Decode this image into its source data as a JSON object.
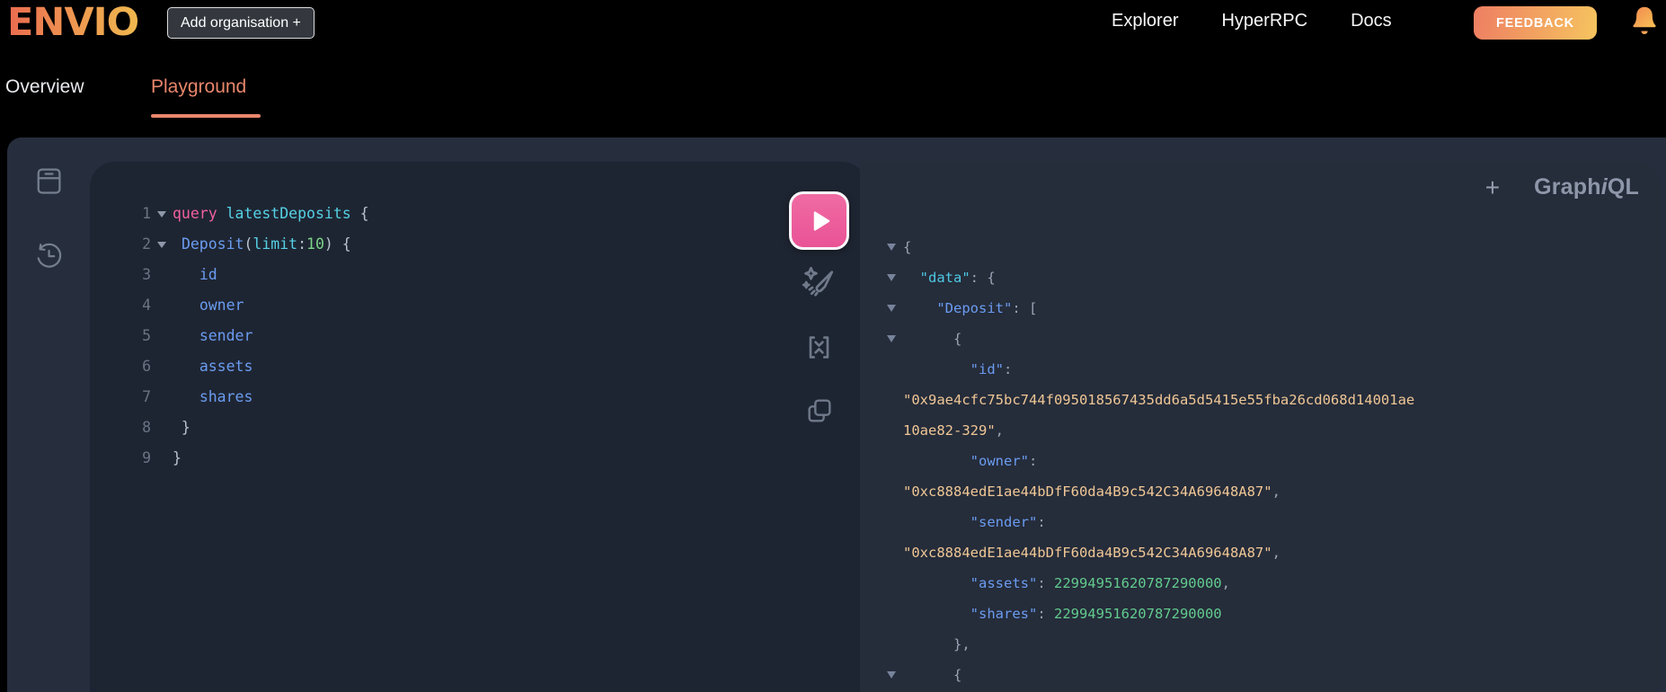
{
  "header": {
    "logo": "ENVIO",
    "add_org_label": "Add organisation +",
    "nav": [
      {
        "label": "Explorer"
      },
      {
        "label": "HyperRPC"
      },
      {
        "label": "Docs"
      }
    ],
    "feedback_label": "FEEDBACK",
    "icons": [
      "bell-icon"
    ]
  },
  "tabs": [
    {
      "label": "Overview",
      "active": false
    },
    {
      "label": "Playground",
      "active": true
    }
  ],
  "sidebar": {
    "icons": [
      "docs-icon",
      "history-icon"
    ]
  },
  "toolbar": {
    "icons": [
      "execute-icon",
      "prettify-icon",
      "merge-icon",
      "copy-icon"
    ]
  },
  "colors": {
    "brand_gradient": [
      "#ea6b50",
      "#eeb84e"
    ],
    "active_tab_accent": "#e8866b",
    "execute_button": "#ee5f9b",
    "keyword_pink": "#f2609e",
    "name_cyan": "#55d1e6",
    "field_blue": "#6b9cf1",
    "number_green": "#62cc8e",
    "string_peach": "#f0c795",
    "container_bg": "#262e3d",
    "editor_bg": "#1e2532",
    "response_bg": "#252c3a"
  },
  "editor": {
    "lines": [
      {
        "n": "1",
        "fold": true,
        "segs": [
          [
            "kw",
            "query"
          ],
          [
            "pl",
            " "
          ],
          [
            "def",
            "latestDeposits"
          ],
          [
            "pl",
            " {"
          ]
        ]
      },
      {
        "n": "2",
        "fold": true,
        "segs": [
          [
            "pl",
            " "
          ],
          [
            "prop",
            "Deposit"
          ],
          [
            "pl",
            "("
          ],
          [
            "attr",
            "limit"
          ],
          [
            "pl",
            ":"
          ],
          [
            "num",
            "10"
          ],
          [
            "pl",
            ") {"
          ]
        ]
      },
      {
        "n": "3",
        "fold": false,
        "segs": [
          [
            "pl",
            "   "
          ],
          [
            "prop",
            "id"
          ]
        ]
      },
      {
        "n": "4",
        "fold": false,
        "segs": [
          [
            "pl",
            "   "
          ],
          [
            "prop",
            "owner"
          ]
        ]
      },
      {
        "n": "5",
        "fold": false,
        "segs": [
          [
            "pl",
            "   "
          ],
          [
            "prop",
            "sender"
          ]
        ]
      },
      {
        "n": "6",
        "fold": false,
        "segs": [
          [
            "pl",
            "   "
          ],
          [
            "prop",
            "assets"
          ]
        ]
      },
      {
        "n": "7",
        "fold": false,
        "segs": [
          [
            "pl",
            "   "
          ],
          [
            "prop",
            "shares"
          ]
        ]
      },
      {
        "n": "8",
        "fold": false,
        "segs": [
          [
            "pl",
            " }"
          ]
        ]
      },
      {
        "n": "9",
        "fold": false,
        "segs": [
          [
            "pl",
            "}"
          ]
        ]
      }
    ]
  },
  "response": {
    "plus_label": "+",
    "logo": {
      "graph": "Graph",
      "i": "i",
      "ql": "QL"
    },
    "lines": [
      {
        "fold": true,
        "segs": [
          [
            "rpl",
            "{"
          ]
        ]
      },
      {
        "fold": true,
        "segs": [
          [
            "rpl",
            "  "
          ],
          [
            "cyan",
            "\"data\""
          ],
          [
            "rpl",
            ": {"
          ]
        ]
      },
      {
        "fold": true,
        "segs": [
          [
            "rpl",
            "    "
          ],
          [
            "key",
            "\"Deposit\""
          ],
          [
            "rpl",
            ": ["
          ]
        ]
      },
      {
        "fold": true,
        "segs": [
          [
            "rpl",
            "      {"
          ]
        ]
      },
      {
        "fold": false,
        "segs": [
          [
            "rpl",
            "        "
          ],
          [
            "key",
            "\"id\""
          ],
          [
            "rpl",
            ":"
          ]
        ]
      },
      {
        "fold": false,
        "segs": [
          [
            "str",
            "\"0x9ae4cfc75bc744f095018567435dd6a5d5415e55fba26cd068d14001ae"
          ]
        ]
      },
      {
        "fold": false,
        "segs": [
          [
            "str",
            "10ae82-329\""
          ],
          [
            "rpl",
            ","
          ]
        ]
      },
      {
        "fold": false,
        "segs": [
          [
            "rpl",
            "        "
          ],
          [
            "key",
            "\"owner\""
          ],
          [
            "rpl",
            ":"
          ]
        ]
      },
      {
        "fold": false,
        "segs": [
          [
            "str",
            "\"0xc8884edE1ae44bDfF60da4B9c542C34A69648A87\""
          ],
          [
            "rpl",
            ","
          ]
        ]
      },
      {
        "fold": false,
        "segs": [
          [
            "rpl",
            "        "
          ],
          [
            "key",
            "\"sender\""
          ],
          [
            "rpl",
            ":"
          ]
        ]
      },
      {
        "fold": false,
        "segs": [
          [
            "str",
            "\"0xc8884edE1ae44bDfF60da4B9c542C34A69648A87\""
          ],
          [
            "rpl",
            ","
          ]
        ]
      },
      {
        "fold": false,
        "segs": [
          [
            "rpl",
            "        "
          ],
          [
            "key",
            "\"assets\""
          ],
          [
            "rpl",
            ": "
          ],
          [
            "rnum",
            "22994951620787290000"
          ],
          [
            "rpl",
            ","
          ]
        ]
      },
      {
        "fold": false,
        "segs": [
          [
            "rpl",
            "        "
          ],
          [
            "key",
            "\"shares\""
          ],
          [
            "rpl",
            ": "
          ],
          [
            "rnum",
            "22994951620787290000"
          ]
        ]
      },
      {
        "fold": false,
        "segs": [
          [
            "rpl",
            "      },"
          ]
        ]
      },
      {
        "fold": true,
        "segs": [
          [
            "rpl",
            "      {"
          ]
        ]
      }
    ]
  }
}
